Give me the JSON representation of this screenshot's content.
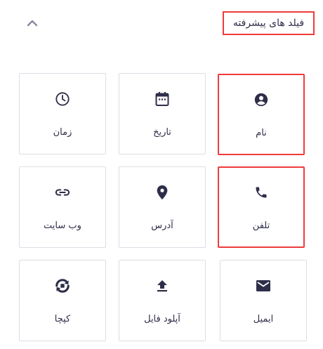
{
  "header": {
    "title": "فیلد های پیشرفته",
    "toggle_icon": "chevron-up-icon"
  },
  "fields": [
    {
      "label": "نام",
      "icon": "account-circle-icon"
    },
    {
      "label": "تاریخ",
      "icon": "calendar-icon"
    },
    {
      "label": "زمان",
      "icon": "clock-icon"
    },
    {
      "label": "تلفن",
      "icon": "phone-icon"
    },
    {
      "label": "آدرس",
      "icon": "location-pin-icon"
    },
    {
      "label": "وب سایت",
      "icon": "link-icon"
    },
    {
      "label": "ایمیل",
      "icon": "email-icon"
    },
    {
      "label": "آپلود فایل",
      "icon": "upload-icon"
    },
    {
      "label": "کپچا",
      "icon": "captcha-icon"
    }
  ],
  "colors": {
    "icon": "#2e2e4a",
    "border": "#dddde6",
    "highlight": "#ef3b3b",
    "chevron": "#8a8aa0"
  }
}
